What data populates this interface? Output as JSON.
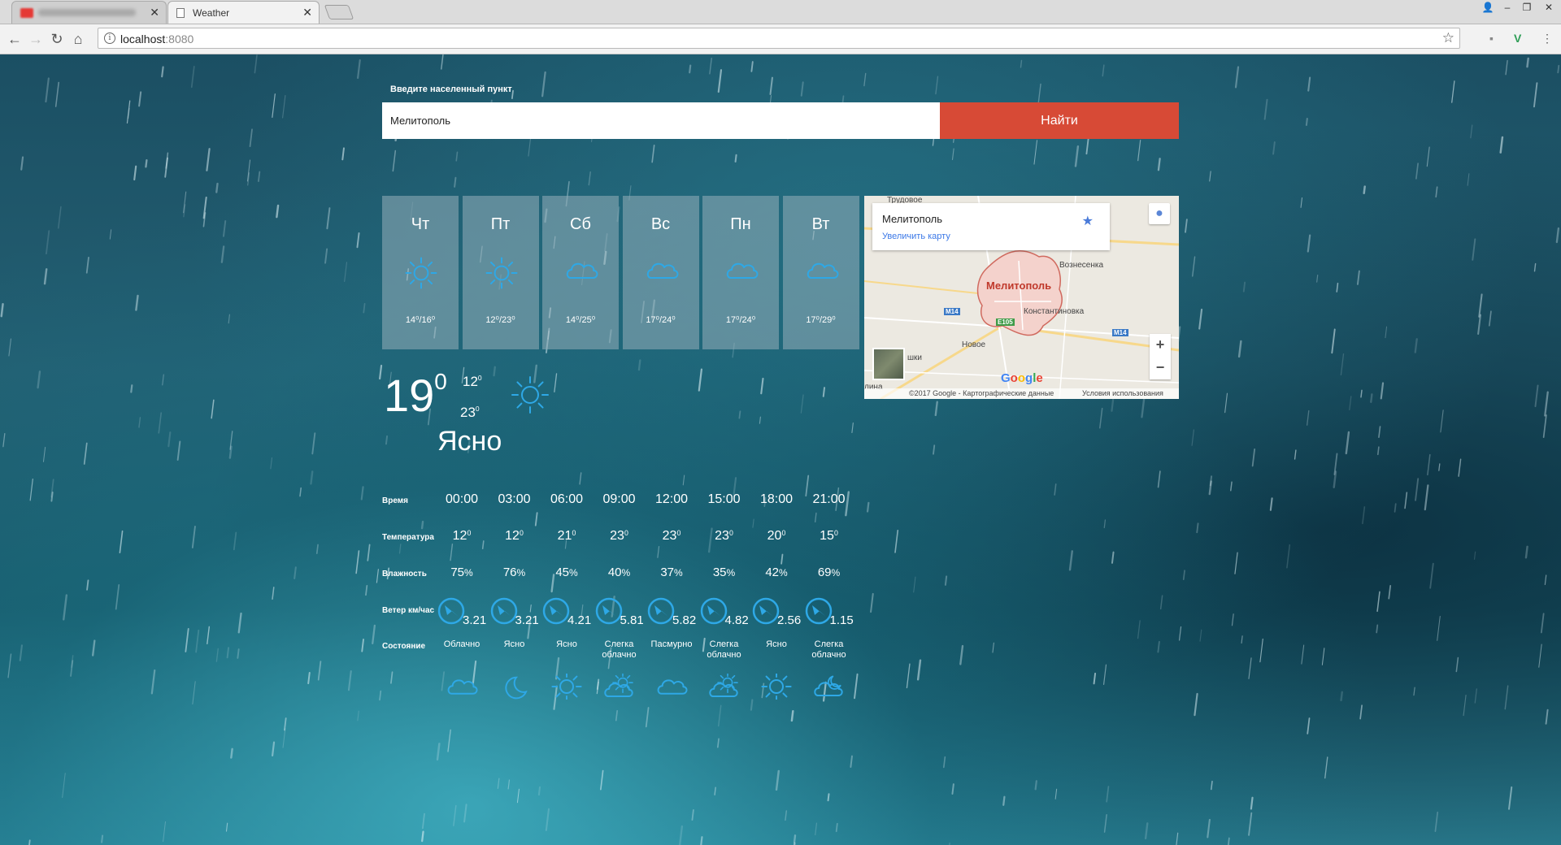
{
  "browser": {
    "tabs": [
      {
        "title": "",
        "active": false
      },
      {
        "title": "Weather",
        "active": true
      }
    ],
    "url_host": "localhost",
    "url_port": ":8080"
  },
  "search": {
    "label": "Введите населенный пункт",
    "value": "Мелитополь",
    "button": "Найти"
  },
  "forecast": [
    {
      "day": "Чт",
      "icon": "sun-icon",
      "temp": "14⁰/16⁰"
    },
    {
      "day": "Пт",
      "icon": "sun-icon",
      "temp": "12⁰/23⁰"
    },
    {
      "day": "Сб",
      "icon": "cloud-icon",
      "temp": "14⁰/25⁰"
    },
    {
      "day": "Вс",
      "icon": "cloud-icon",
      "temp": "17⁰/24⁰"
    },
    {
      "day": "Пн",
      "icon": "cloud-icon",
      "temp": "17⁰/24⁰"
    },
    {
      "day": "Вт",
      "icon": "cloud-icon",
      "temp": "17⁰/29⁰"
    }
  ],
  "map": {
    "place": "Мелитополь",
    "enlarge_link": "Увеличить карту",
    "labels": [
      "Трудовое",
      "Вознесенка",
      "Константиновка",
      "Новое",
      "шки",
      "лина"
    ],
    "roads": [
      "M14",
      "E105",
      "M14"
    ],
    "copyright": "©2017 Google - Картографические данные",
    "terms": "Условия использования",
    "logo": "Google",
    "zoom_in": "+",
    "zoom_out": "−"
  },
  "current": {
    "temp": "19",
    "low": "12",
    "high": "23",
    "icon": "sun-icon",
    "description": "Ясно",
    "degree_mark": "0"
  },
  "hourly": {
    "labels": {
      "time": "Время",
      "temperature": "Температура",
      "humidity": "Влажность",
      "wind": "Ветер км/час",
      "state": "Состояние"
    },
    "items": [
      {
        "time": "00:00",
        "temp": "12",
        "humidity": "75",
        "wind": "3.21",
        "state": "Облачно",
        "icon": "cloud-icon"
      },
      {
        "time": "03:00",
        "temp": "12",
        "humidity": "76",
        "wind": "3.21",
        "state": "Ясно",
        "icon": "moon-icon"
      },
      {
        "time": "06:00",
        "temp": "21",
        "humidity": "45",
        "wind": "4.21",
        "state": "Ясно",
        "icon": "sun-icon"
      },
      {
        "time": "09:00",
        "temp": "23",
        "humidity": "40",
        "wind": "5.81",
        "state": "Слегка облачно",
        "icon": "sun-cloud-icon"
      },
      {
        "time": "12:00",
        "temp": "23",
        "humidity": "37",
        "wind": "5.82",
        "state": "Пасмурно",
        "icon": "cloud-icon"
      },
      {
        "time": "15:00",
        "temp": "23",
        "humidity": "35",
        "wind": "4.82",
        "state": "Слегка облачно",
        "icon": "sun-cloud-icon"
      },
      {
        "time": "18:00",
        "temp": "20",
        "humidity": "42",
        "wind": "2.56",
        "state": "Ясно",
        "icon": "sun-icon"
      },
      {
        "time": "21:00",
        "temp": "15",
        "humidity": "69",
        "wind": "1.15",
        "state": "Слегка облачно",
        "icon": "moon-cloud-icon"
      }
    ],
    "percent": "%"
  },
  "colors": {
    "accent": "#d74a36",
    "icon": "#2ea8e6"
  }
}
